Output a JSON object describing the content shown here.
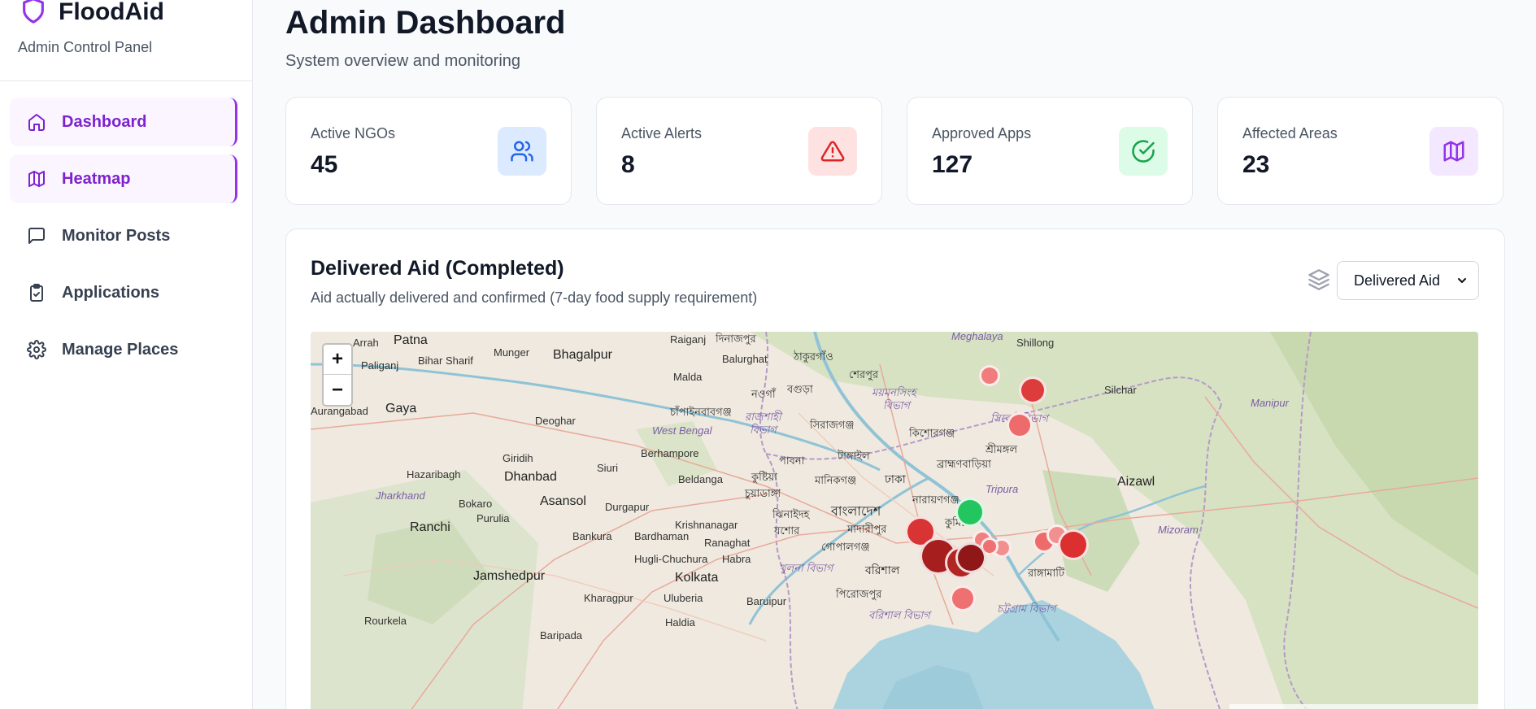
{
  "brand": {
    "name": "FloodAid",
    "subtitle": "Admin Control Panel",
    "logo_icon": "shield-icon",
    "accent": "#9333ea"
  },
  "sidebar": {
    "items": [
      {
        "label": "Dashboard",
        "icon": "home-icon",
        "active": true
      },
      {
        "label": "Heatmap",
        "icon": "map-icon",
        "active": true
      },
      {
        "label": "Monitor Posts",
        "icon": "message-icon",
        "active": false
      },
      {
        "label": "Applications",
        "icon": "clipboard-check-icon",
        "active": false
      },
      {
        "label": "Manage Places",
        "icon": "gear-icon",
        "active": false
      }
    ]
  },
  "header": {
    "title": "Admin Dashboard",
    "subtitle": "System overview and monitoring"
  },
  "stats": [
    {
      "label": "Active NGOs",
      "value": "45",
      "icon": "users-icon",
      "color": "#2563eb",
      "bg": "#dbeafe"
    },
    {
      "label": "Active Alerts",
      "value": "8",
      "icon": "alert-triangle-icon",
      "color": "#dc2626",
      "bg": "#fee2e2"
    },
    {
      "label": "Approved Apps",
      "value": "127",
      "icon": "check-circle-icon",
      "color": "#16a34a",
      "bg": "#dcfce7"
    },
    {
      "label": "Affected Areas",
      "value": "23",
      "icon": "map-icon",
      "color": "#9333ea",
      "bg": "#f3e8ff"
    }
  ],
  "map_panel": {
    "title": "Delivered Aid (Completed)",
    "subtitle": "Aid actually delivered and confirmed (7-day food supply requirement)",
    "layer_select": {
      "value": "Delivered Aid"
    },
    "zoom_in": "+",
    "zoom_out": "−",
    "labels": {
      "patna": "Patna",
      "arrah": "Arrah",
      "munger": "Munger",
      "bhagalpur": "Bhagalpur",
      "raiganj": "Raiganj",
      "dinajpur": "দিনাজপুর",
      "balurghat": "Balurghat",
      "thakurgaon": "ঠাকুরগাঁও",
      "meghalaya": "Meghalaya",
      "shillong": "Shillong",
      "paliganj": "Paliganj",
      "biharsharif": "Bihar Sharif",
      "malda": "Malda",
      "naogaon": "নওগাঁ",
      "bogura": "বগুড়া",
      "sherpur": "শেরপুর",
      "mymensingh": "ময়মনসিংহ",
      "bibhag1": "বিভাগ",
      "silchar": "Silchar",
      "aurangabad": "Aurangabad",
      "gaya": "Gaya",
      "chapai": "চাঁপাইনবাবগঞ্জ",
      "rajshahi": "রাজশাহী",
      "bibhag2": "বিভাগ",
      "deoghar": "Deoghar",
      "westbengal": "West Bengal",
      "sirajganj": "সিরাজগঞ্জ",
      "kishoreganj": "কিশোরগঞ্জ",
      "sylhet": "সিলেট বিভাগ",
      "manipur": "Manipur",
      "sreemangal": "শ্রীমঙ্গল",
      "berhampore": "Berhampore",
      "pabna": "পাবনা",
      "tangail": "টাঙ্গাইল",
      "brahmanbaria": "ব্রাহ্মণবাড়িয়া",
      "giridih": "Giridih",
      "hazaribagh": "Hazaribagh",
      "dhanbad": "Dhanbad",
      "siuri": "Siuri",
      "beldanga": "Beldanga",
      "kushtia": "কুষ্টিয়া",
      "manikganj": "মানিকগঞ্জ",
      "dhaka": "ঢাকা",
      "tripura": "Tripura",
      "aizawl": "Aizawl",
      "jharkhand": "Jharkhand",
      "bokaro": "Bokaro",
      "asansol": "Asansol",
      "durgapur": "Durgapur",
      "chuadanga": "চুয়াডাঙ্গা",
      "narayanganj": "নারায়ণগঞ্জ",
      "purulia": "Purulia",
      "jhenaidah": "ঝিনাইদহ",
      "bangladesh": "বাংলাদেশ",
      "ranchi": "Ranchi",
      "krishnanagar": "Krishnanagar",
      "jessore": "যশোর",
      "madaripur": "মাদারীপুর",
      "comilla": "কুমিল্লা",
      "mizoram": "Mizoram",
      "bankura": "Bankura",
      "bardhaman": "Bardhaman",
      "ranaghat": "Ranaghat",
      "gopalganj": "গোপালগঞ্জ",
      "hugli": "Hugli-Chuchura",
      "habra": "Habra",
      "khulna": "খুলনা বিভাগ",
      "barishal": "বরিশাল",
      "rangamati": "রাঙ্গামাটি",
      "jamshedpur": "Jamshedpur",
      "kolkata": "Kolkata",
      "kharagpur": "Kharagpur",
      "uluberia": "Uluberia",
      "baruipur": "Baruipur",
      "pirojpur": "পিরোজপুর",
      "rourkela": "Rourkela",
      "haldia": "Haldia",
      "baripada": "Baripada",
      "barishalbibhag": "বরিশাল বিভাগ",
      "chittagong": "চট্টগ্রাম বিভাগ"
    }
  }
}
